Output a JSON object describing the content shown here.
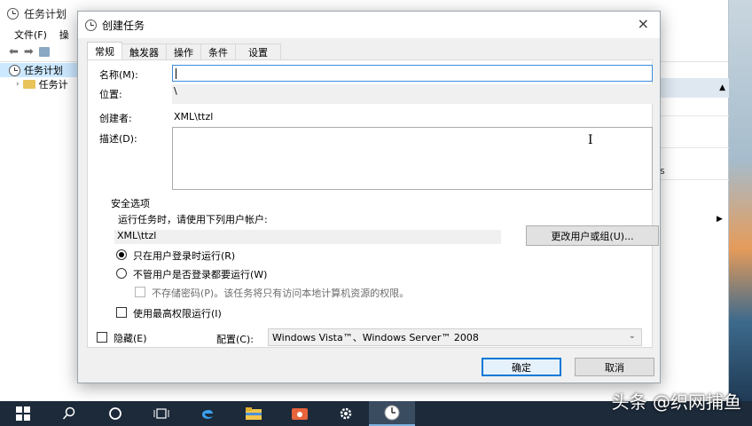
{
  "background_window": {
    "title": "任务计划",
    "menu": [
      "文件(F)",
      "操"
    ],
    "tree": [
      {
        "label": "任务计划",
        "selected": true
      },
      {
        "label": "任务计",
        "selected": false
      }
    ],
    "right_mark": "s"
  },
  "dialog": {
    "title": "创建任务",
    "close": "×",
    "tabs": [
      "常规",
      "触发器",
      "操作",
      "条件",
      "设置"
    ],
    "active_tab": "常规",
    "general": {
      "name_label": "名称(M):",
      "name_value": "",
      "location_label": "位置:",
      "location_value": "\\",
      "author_label": "创建者:",
      "author_value": "XML\\ttzl",
      "description_label": "描述(D):",
      "description_value": ""
    },
    "security": {
      "group_title": "安全选项",
      "run_as_prompt": "运行任务时，请使用下列用户帐户:",
      "user_value": "XML\\ttzl",
      "change_user_button": "更改用户或组(U)...",
      "radio_logged_on": "只在用户登录时运行(R)",
      "radio_whether_logged": "不管用户是否登录都要运行(W)",
      "check_no_store_password": "不存储密码(P)。该任务将只有访问本地计算机资源的权限。",
      "check_highest_privileges": "使用最高权限运行(I)"
    },
    "hidden_label": "隐藏(E)",
    "config_label": "配置(C):",
    "config_value": "Windows Vista™、Windows Server™ 2008",
    "ok_button": "确定",
    "cancel_button": "取消"
  },
  "watermark": "头条 @织网捕鱼",
  "colors": {
    "focus_border": "#3c8ce0",
    "ok_border": "#0078d7",
    "taskbar": "#1c2a3a"
  }
}
